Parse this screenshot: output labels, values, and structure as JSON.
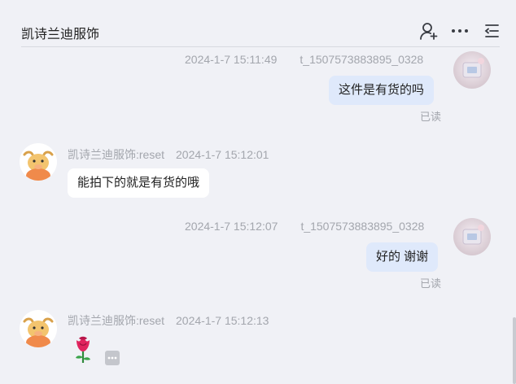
{
  "header": {
    "title": "凯诗兰迪服饰"
  },
  "messages": [
    {
      "time": "2024-1-7 15:11:49",
      "sender": "t_1507573883895_0328",
      "text": "这件是有货的吗",
      "status": "已读"
    },
    {
      "sender": "凯诗兰迪服饰:reset",
      "time": "2024-1-7 15:12:01",
      "text": "能拍下的就是有货的哦"
    },
    {
      "time": "2024-1-7 15:12:07",
      "sender": "t_1507573883895_0328",
      "text": "好的 谢谢",
      "status": "已读"
    },
    {
      "sender": "凯诗兰迪服饰:reset",
      "time": "2024-1-7 15:12:13"
    }
  ],
  "icons": {
    "add_user": "add-user-icon",
    "more": "more-icon",
    "menu": "menu-icon",
    "rose": "rose-icon",
    "more_actions": "more-actions-icon"
  }
}
